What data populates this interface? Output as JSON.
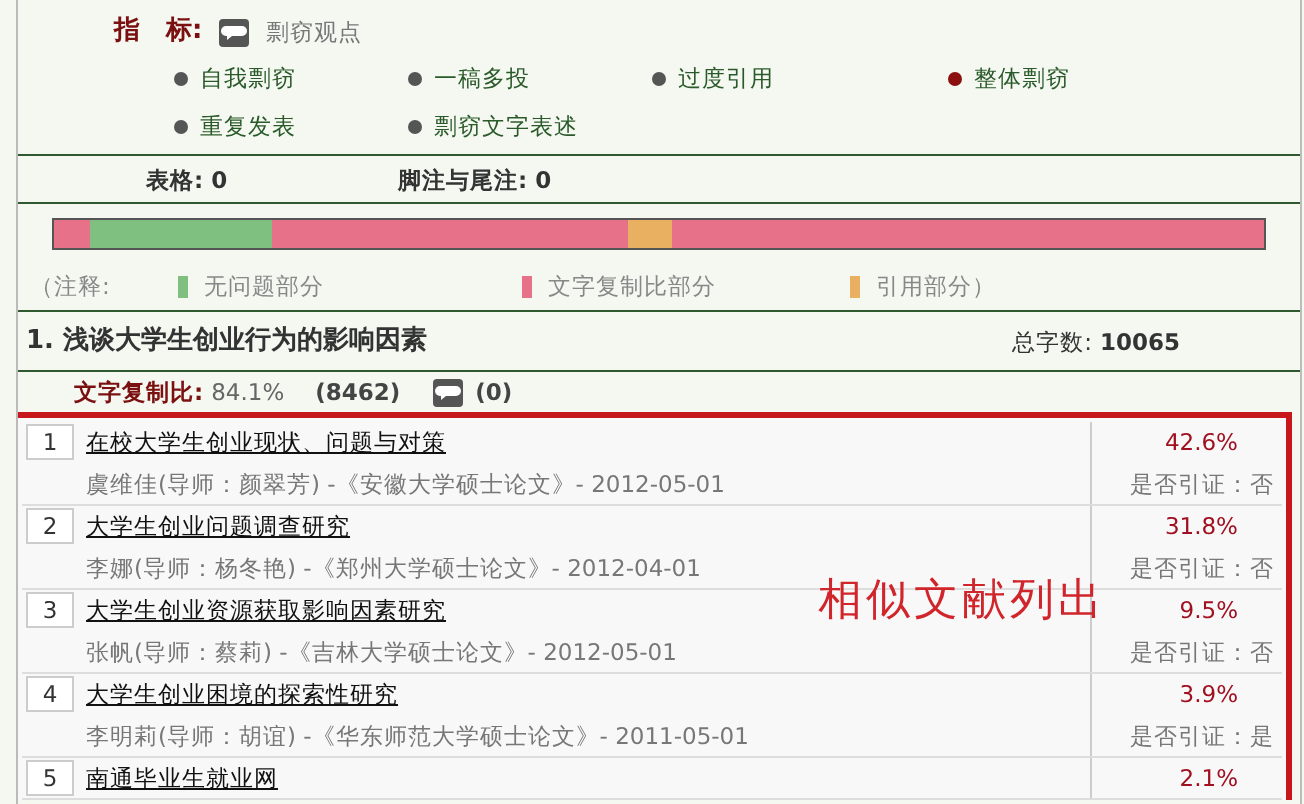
{
  "indicator": {
    "label": "指　标:",
    "link": "剽窃观点"
  },
  "flags": [
    {
      "label": "自我剽窃",
      "selected": false
    },
    {
      "label": "一稿多投",
      "selected": false
    },
    {
      "label": "过度引用",
      "selected": false
    },
    {
      "label": "整体剽窃",
      "selected": true
    },
    {
      "label": "重复发表",
      "selected": false
    },
    {
      "label": "剽窃文字表述",
      "selected": false
    }
  ],
  "counts": [
    {
      "label": "表格:",
      "value": "0"
    },
    {
      "label": "脚注与尾注:",
      "value": "0"
    }
  ],
  "bar": [
    {
      "kind": "copied"
    },
    {
      "kind": "clean"
    },
    {
      "kind": "copied"
    },
    {
      "kind": "quoted"
    },
    {
      "kind": "copied"
    }
  ],
  "legend": {
    "prefix": "（注释:",
    "items": [
      {
        "label": "无问题部分",
        "color": "#7fbf7f"
      },
      {
        "label": "文字复制比部分",
        "color": "#e8718a"
      },
      {
        "label": "引用部分）",
        "color": "#e8b060"
      }
    ]
  },
  "document": {
    "title": "1. 浅谈大学生创业行为的影响因素",
    "total_label": "总字数:",
    "total": "10065",
    "ratio_label": "文字复制比:",
    "ratio": "84.1%",
    "chars": "(8462)",
    "comments": "(0)"
  },
  "sources": [
    {
      "index": "1",
      "title": "在校大学生创业现状、问题与对策",
      "meta": "虞维佳(导师：颜翠芳) -《安徽大学硕士论文》- 2012-05-01",
      "percent": "42.6%",
      "cited": "是否引证：否"
    },
    {
      "index": "2",
      "title": "大学生创业问题调查研究",
      "meta": "李娜(导师：杨冬艳) -《郑州大学硕士论文》- 2012-04-01",
      "percent": "31.8%",
      "cited": "是否引证：否"
    },
    {
      "index": "3",
      "title": "大学生创业资源获取影响因素研究",
      "meta": "张帆(导师：蔡莉) -《吉林大学硕士论文》- 2012-05-01",
      "percent": "9.5%",
      "cited": "是否引证：否"
    },
    {
      "index": "4",
      "title": "大学生创业困境的探索性研究",
      "meta": "李明莉(导师：胡谊) -《华东师范大学硕士论文》- 2011-05-01",
      "percent": "3.9%",
      "cited": "是否引证：是"
    },
    {
      "index": "5",
      "title": "南通毕业生就业网",
      "percent": "2.1%"
    }
  ],
  "annotation": {
    "text": "相似文献列出"
  }
}
